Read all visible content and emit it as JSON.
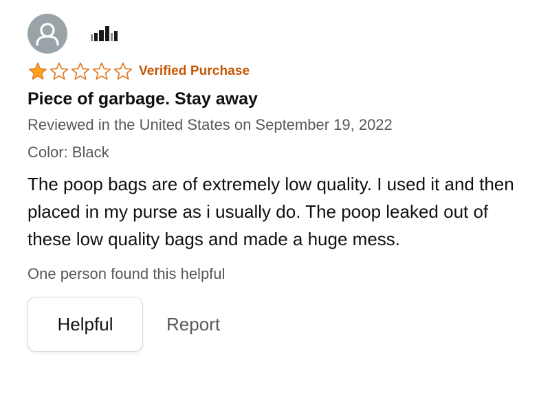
{
  "review": {
    "reviewer_name": "",
    "star_rating": 1,
    "star_max": 5,
    "verified_label": "Verified Purchase",
    "title": "Piece of garbage. Stay away",
    "reviewed_line": "Reviewed in the United States on September 19, 2022",
    "variant_line": "Color: Black",
    "body": "The poop bags are of extremely low quality. I used it and then placed in my purse as i usually do. The poop leaked out of these low quality bags and made a huge mess.",
    "helpful_count_text": "One person found this helpful",
    "helpful_button_label": "Helpful",
    "report_label": "Report"
  },
  "icons": {
    "avatar": "user-avatar-icon",
    "star_filled": "star-filled-icon",
    "star_empty": "star-outline-icon"
  },
  "colors": {
    "star": "#ffa41c",
    "star_outline": "#de7921",
    "verified": "#c45500",
    "secondary_text": "#565959",
    "avatar_bg": "#9aa3a8"
  }
}
